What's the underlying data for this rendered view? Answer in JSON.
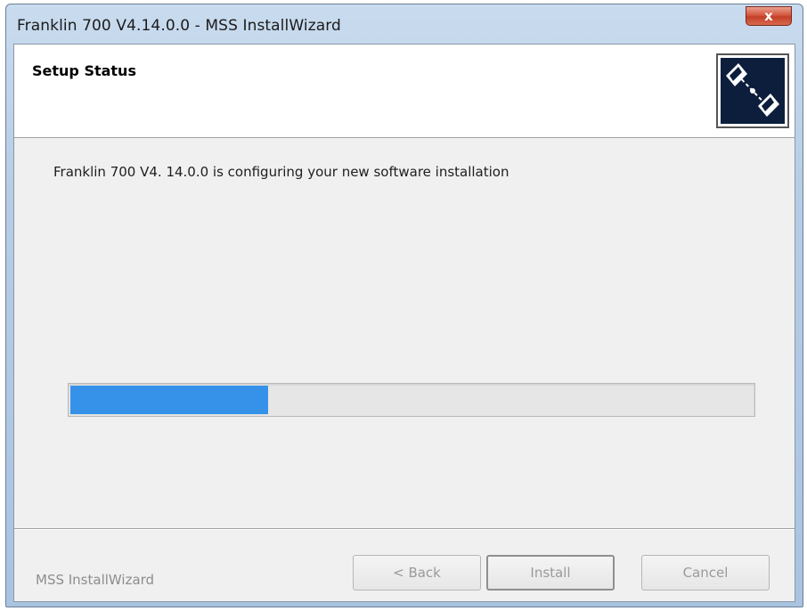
{
  "window": {
    "title": "Franklin 700 V4.14.0.0 - MSS InstallWizard",
    "close_label": "x"
  },
  "header": {
    "title": "Setup Status",
    "logo_icon": "install-wizard-logo-icon"
  },
  "main": {
    "status_text": "Franklin 700 V4. 14.0.0 is configuring your new software installation",
    "progress_fraction": 0.29
  },
  "footer": {
    "brand": "MSS InstallWizard",
    "back_label": "< Back",
    "install_label": "Install",
    "cancel_label": "Cancel"
  },
  "colors": {
    "progress_fill": "#3592e8",
    "client_bg": "#f0f0f0",
    "header_bg": "#ffffff"
  }
}
